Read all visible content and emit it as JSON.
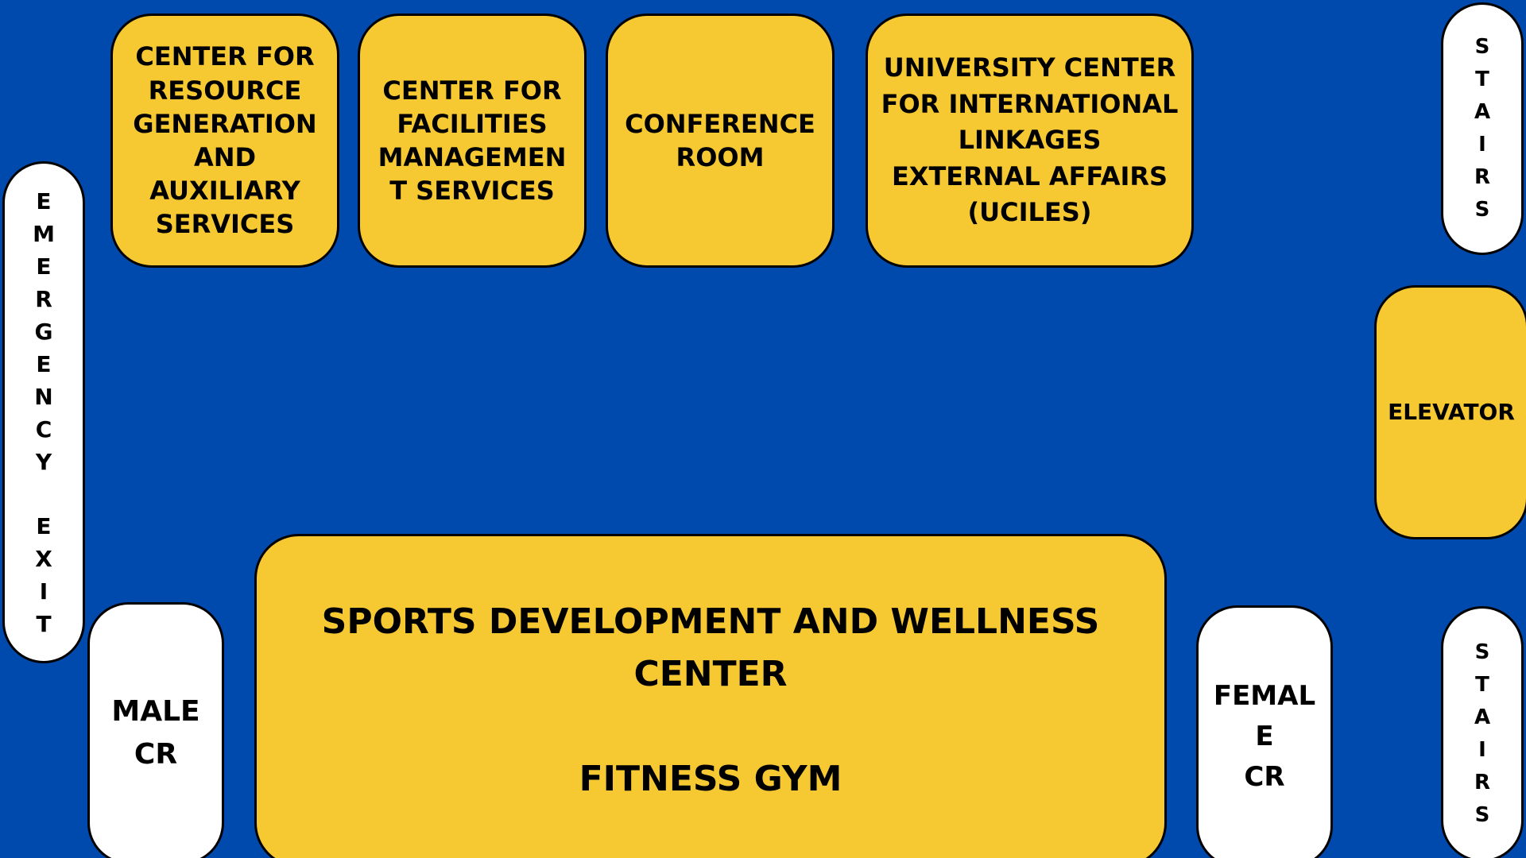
{
  "colors": {
    "background": "#004aad",
    "room_fill": "#f6c933",
    "utility_fill": "#ffffff",
    "outline": "#000000"
  },
  "rooms": {
    "crgas": [
      "CENTER FOR",
      "RESOURCE",
      "GENERATION",
      "AND",
      "AUXILIARY",
      "SERVICES"
    ],
    "cfms": [
      "CENTER FOR",
      "FACILITIES",
      "MANAGEMEN",
      "T SERVICES"
    ],
    "conference": [
      "CONFERENCE",
      "ROOM"
    ],
    "uciles": [
      "UNIVERSITY CENTER",
      "FOR INTERNATIONAL",
      "LINKAGES",
      "EXTERNAL AFFAIRS",
      "(UCILES)"
    ],
    "gym": {
      "lines": [
        "SPORTS DEVELOPMENT AND WELLNESS",
        "CENTER"
      ],
      "subtitle": "FITNESS GYM"
    },
    "male_cr": [
      "MALE",
      "CR"
    ],
    "female_cr": [
      "FEMAL",
      "E",
      "CR"
    ],
    "elevator": "ELEVATOR"
  },
  "exits": {
    "emergency_exit": [
      "E",
      "M",
      "E",
      "R",
      "G",
      "E",
      "N",
      "C",
      "Y",
      "",
      "E",
      "X",
      "I",
      "T"
    ],
    "stairs_top": [
      "S",
      "T",
      "A",
      "I",
      "R",
      "S"
    ],
    "stairs_bottom": [
      "S",
      "T",
      "A",
      "I",
      "R",
      "S"
    ]
  }
}
